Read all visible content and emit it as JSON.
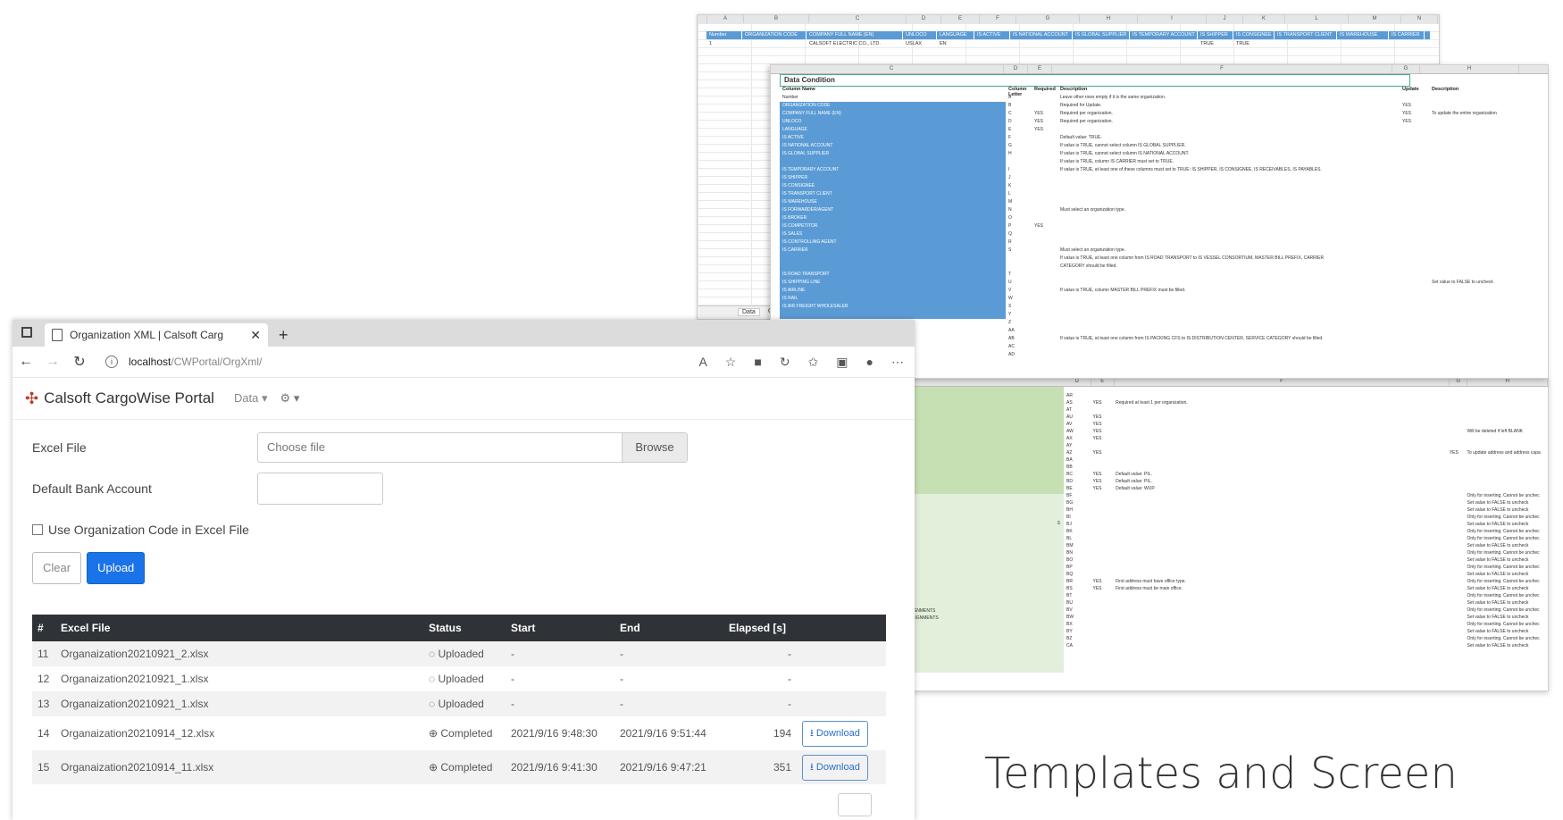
{
  "sheet1": {
    "col_letters": [
      "A",
      "B",
      "C",
      "D",
      "E",
      "F",
      "G",
      "H",
      "I",
      "J",
      "K",
      "L",
      "M",
      "N"
    ],
    "headers": [
      "Number",
      "ORGANIZATION CODE",
      "COMPANY FULL NAME (EN)",
      "UNLOCO",
      "LANGUAGE",
      "IS ACTIVE",
      "IS NATIONAL ACCOUNT",
      "IS GLOBAL SUPPLIER",
      "IS TEMPORARY ACCOUNT",
      "IS SHIPPER",
      "IS CONSIGNEE",
      "IS TRANSPORT CLIENT",
      "IS WAREHOUSE",
      "IS CARRIER"
    ],
    "row": [
      "1",
      "",
      "CALSOFT ELECTRIC CO., LTD.",
      "USLAX",
      "EN",
      "",
      "",
      "",
      "",
      "TRUE",
      "TRUE",
      "",
      "",
      ""
    ],
    "tabs": [
      "Data",
      "Cl"
    ]
  },
  "sheet2": {
    "title": "Data Condition",
    "head": {
      "name": "Column Name",
      "letter": "Column Letter",
      "req": "Required",
      "desc": "Description",
      "upd": "Update",
      "udesc": "Description"
    },
    "rows": [
      {
        "name": "Number",
        "letter": "A",
        "req": "",
        "desc": "Leave other rows empty if it is the same organization.",
        "upd": "",
        "udesc": ""
      },
      {
        "name": "ORGANIZATION CODE",
        "letter": "B",
        "req": "",
        "desc": "Required for Update.",
        "upd": "YES",
        "udesc": ""
      },
      {
        "name": "COMPANY FULL NAME (EN)",
        "letter": "C",
        "req": "YES",
        "desc": "Required per organization.",
        "upd": "YES",
        "udesc": "To update the entire organization"
      },
      {
        "name": "UNLOCO",
        "letter": "D",
        "req": "YES",
        "desc": "Required per organization.",
        "upd": "YES",
        "udesc": ""
      },
      {
        "name": "LANGUAGE",
        "letter": "E",
        "req": "YES",
        "desc": "",
        "upd": "",
        "udesc": ""
      },
      {
        "name": "IS ACTIVE",
        "letter": "F",
        "req": "",
        "desc": "Default value: TRUE.",
        "upd": "",
        "udesc": ""
      },
      {
        "name": "IS NATIONAL ACCOUNT",
        "letter": "G",
        "req": "",
        "desc": "If value is TRUE, cannot select column IS GLOBAL SUPPLIER.",
        "upd": "",
        "udesc": ""
      },
      {
        "name": "IS GLOBAL SUPPLIER",
        "letter": "H",
        "req": "",
        "desc": "If value is TRUE, cannot select column IS NATIONAL ACCOUNT.",
        "upd": "",
        "udesc": ""
      },
      {
        "name": "",
        "letter": "",
        "req": "",
        "desc": "If value is TRUE, column IS CARRIER must set to TRUE.",
        "upd": "",
        "udesc": ""
      },
      {
        "name": "IS TEMPORARY ACCOUNT",
        "letter": "I",
        "req": "",
        "desc": "If value is TRUE, at least one of these columns must set to TRUE: IS SHIPPER, IS CONSIGNEE, IS RECEIVABLES, IS PAYABLES.",
        "upd": "",
        "udesc": ""
      },
      {
        "name": "IS SHIPPER",
        "letter": "J",
        "req": "",
        "desc": "",
        "upd": "",
        "udesc": ""
      },
      {
        "name": "IS CONSIGNEE",
        "letter": "K",
        "req": "",
        "desc": "",
        "upd": "",
        "udesc": ""
      },
      {
        "name": "IS TRANSPORT CLIENT",
        "letter": "L",
        "req": "",
        "desc": "",
        "upd": "",
        "udesc": ""
      },
      {
        "name": "IS WAREHOUSE",
        "letter": "M",
        "req": "",
        "desc": "",
        "upd": "",
        "udesc": ""
      },
      {
        "name": "IS FORWARDER/AGENT",
        "letter": "N",
        "req": "",
        "desc": "Must select an organization type.",
        "upd": "",
        "udesc": ""
      },
      {
        "name": "IS BROKER",
        "letter": "O",
        "req": "",
        "desc": "",
        "upd": "",
        "udesc": ""
      },
      {
        "name": "IS COMPETITOR",
        "letter": "P",
        "req": "YES",
        "desc": "",
        "upd": "",
        "udesc": ""
      },
      {
        "name": "IS SALES",
        "letter": "Q",
        "req": "",
        "desc": "",
        "upd": "",
        "udesc": ""
      },
      {
        "name": "IS CONTROLLING AGENT",
        "letter": "R",
        "req": "",
        "desc": "",
        "upd": "",
        "udesc": ""
      },
      {
        "name": "IS CARRIER",
        "letter": "S",
        "req": "",
        "desc": "Must select an organization type.",
        "upd": "",
        "udesc": ""
      },
      {
        "name": "",
        "letter": "",
        "req": "",
        "desc": "If value is TRUE, at least one column from IS ROAD TRANSPORT to IS VESSEL CONSORTIUM, MASTER BILL PREFIX, CARRIER",
        "upd": "",
        "udesc": ""
      },
      {
        "name": "",
        "letter": "",
        "req": "",
        "desc": "CATEGORY should be filled.",
        "upd": "",
        "udesc": ""
      },
      {
        "name": "IS ROAD TRANSPORT",
        "letter": "T",
        "req": "",
        "desc": "",
        "upd": "",
        "udesc": ""
      },
      {
        "name": "IS SHIPPING LINE",
        "letter": "U",
        "req": "",
        "desc": "",
        "upd": "",
        "udesc": "Set value to FALSE to uncheck"
      },
      {
        "name": "IS AIRLINE",
        "letter": "V",
        "req": "",
        "desc": "If value is TRUE, column MASTER BILL PREFIX must be filled.",
        "upd": "",
        "udesc": ""
      },
      {
        "name": "IS RAIL",
        "letter": "W",
        "req": "",
        "desc": "",
        "upd": "",
        "udesc": ""
      },
      {
        "name": "IS AIR FREIGHT WHOLESALER",
        "letter": "X",
        "req": "",
        "desc": "",
        "upd": "",
        "udesc": ""
      },
      {
        "name": "",
        "letter": "Y",
        "req": "",
        "desc": "",
        "upd": "",
        "udesc": ""
      },
      {
        "name": "",
        "letter": "Z",
        "req": "",
        "desc": "",
        "upd": "",
        "udesc": ""
      },
      {
        "name": "",
        "letter": "AA",
        "req": "",
        "desc": "",
        "upd": "",
        "udesc": ""
      },
      {
        "name": "",
        "letter": "AB",
        "req": "",
        "desc": "If value is TRUE, at least one column from IS PACKING CFS to IS DISTRIBUTION CENTER, SERVICE CATEGORY should be filled.",
        "upd": "",
        "udesc": ""
      },
      {
        "name": "",
        "letter": "AC",
        "req": "",
        "desc": "",
        "upd": "",
        "udesc": ""
      },
      {
        "name": "",
        "letter": "AD",
        "req": "",
        "desc": "",
        "upd": "",
        "udesc": ""
      }
    ]
  },
  "sheet3": {
    "side_labels": [
      "S",
      "IGNMENTS",
      "SIGNMENTS"
    ],
    "rows": [
      {
        "letter": "AR",
        "req": "",
        "desc": "",
        "upd": "",
        "udesc": ""
      },
      {
        "letter": "AS",
        "req": "YES",
        "desc": "Required at least 1 per organization.",
        "upd": "",
        "udesc": ""
      },
      {
        "letter": "AT",
        "req": "",
        "desc": "",
        "upd": "",
        "udesc": ""
      },
      {
        "letter": "AU",
        "req": "YES",
        "desc": "",
        "upd": "",
        "udesc": ""
      },
      {
        "letter": "AV",
        "req": "YES",
        "desc": "",
        "upd": "",
        "udesc": ""
      },
      {
        "letter": "AW",
        "req": "YES",
        "desc": "",
        "upd": "",
        "udesc": "Will be deleted if left BLANK"
      },
      {
        "letter": "AX",
        "req": "YES",
        "desc": "",
        "upd": "",
        "udesc": ""
      },
      {
        "letter": "AY",
        "req": "",
        "desc": "",
        "upd": "",
        "udesc": ""
      },
      {
        "letter": "AZ",
        "req": "YES",
        "desc": "",
        "upd": "YES",
        "udesc": "To update address and address capa"
      },
      {
        "letter": "BA",
        "req": "",
        "desc": "",
        "upd": "",
        "udesc": ""
      },
      {
        "letter": "BB",
        "req": "",
        "desc": "",
        "upd": "",
        "udesc": ""
      },
      {
        "letter": "BC",
        "req": "YES",
        "desc": "Default value: PIL.",
        "upd": "",
        "udesc": ""
      },
      {
        "letter": "BD",
        "req": "YES",
        "desc": "Default value: PIL.",
        "upd": "",
        "udesc": ""
      },
      {
        "letter": "BE",
        "req": "YES",
        "desc": "Default value: WUP.",
        "upd": "",
        "udesc": ""
      },
      {
        "letter": "BF",
        "req": "",
        "desc": "",
        "upd": "",
        "udesc": "Only for inserting. Cannot be unchec"
      },
      {
        "letter": "BG",
        "req": "",
        "desc": "",
        "upd": "",
        "udesc": "Set value to FALSE to uncheck"
      },
      {
        "letter": "BH",
        "req": "",
        "desc": "",
        "upd": "",
        "udesc": "Set value to FALSE to uncheck"
      },
      {
        "letter": "BI",
        "req": "",
        "desc": "",
        "upd": "",
        "udesc": "Only for inserting. Cannot be unchec"
      },
      {
        "letter": "BJ",
        "req": "",
        "desc": "",
        "upd": "",
        "udesc": "Set value to FALSE to uncheck"
      },
      {
        "letter": "BK",
        "req": "",
        "desc": "",
        "upd": "",
        "udesc": "Only for inserting. Cannot be unchec"
      },
      {
        "letter": "BL",
        "req": "",
        "desc": "",
        "upd": "",
        "udesc": "Only for inserting. Cannot be unchec"
      },
      {
        "letter": "BM",
        "req": "",
        "desc": "",
        "upd": "",
        "udesc": "Set value to FALSE to uncheck"
      },
      {
        "letter": "BN",
        "req": "",
        "desc": "",
        "upd": "",
        "udesc": "Only for inserting. Cannot be unchec"
      },
      {
        "letter": "BO",
        "req": "",
        "desc": "",
        "upd": "",
        "udesc": "Set value to FALSE to uncheck"
      },
      {
        "letter": "BP",
        "req": "",
        "desc": "",
        "upd": "",
        "udesc": "Only for inserting. Cannot be unchec"
      },
      {
        "letter": "BQ",
        "req": "",
        "desc": "",
        "upd": "",
        "udesc": "Set value to FALSE to uncheck"
      },
      {
        "letter": "BR",
        "req": "YES",
        "desc": "First address must have office type.",
        "upd": "",
        "udesc": "Only for inserting. Cannot be unchec"
      },
      {
        "letter": "BS",
        "req": "YES",
        "desc": "First address must be main office.",
        "upd": "",
        "udesc": "Set value to FALSE to uncheck"
      },
      {
        "letter": "BT",
        "req": "",
        "desc": "",
        "upd": "",
        "udesc": "Only for inserting. Cannot be unchec"
      },
      {
        "letter": "BU",
        "req": "",
        "desc": "",
        "upd": "",
        "udesc": "Set value to FALSE to uncheck"
      },
      {
        "letter": "BV",
        "req": "",
        "desc": "",
        "upd": "",
        "udesc": "Only for inserting. Cannot be unchec"
      },
      {
        "letter": "BW",
        "req": "",
        "desc": "",
        "upd": "",
        "udesc": "Set value to FALSE to uncheck"
      },
      {
        "letter": "BX",
        "req": "",
        "desc": "",
        "upd": "",
        "udesc": "Only for inserting. Cannot be unchec"
      },
      {
        "letter": "BY",
        "req": "",
        "desc": "",
        "upd": "",
        "udesc": "Set value to FALSE to uncheck"
      },
      {
        "letter": "BZ",
        "req": "",
        "desc": "",
        "upd": "",
        "udesc": "Only for inserting. Cannot be unchec"
      },
      {
        "letter": "CA",
        "req": "",
        "desc": "",
        "upd": "",
        "udesc": "Set value to FALSE to uncheck"
      }
    ]
  },
  "browser": {
    "tab_title": "Organization XML | Calsoft Carg",
    "url_host": "localhost",
    "url_path": "/CWPortal/OrgXml/",
    "brand": "Calsoft CargoWise Portal",
    "nav_data": "Data ▾",
    "nav_settings": "⚙ ▾"
  },
  "form": {
    "excel_label": "Excel File",
    "file_placeholder": "Choose file",
    "browse_label": "Browse",
    "bank_label": "Default Bank Account",
    "checkbox_label": "Use Organization Code in Excel File",
    "clear_label": "Clear",
    "upload_label": "Upload"
  },
  "table": {
    "headers": [
      "#",
      "Excel File",
      "Status",
      "Start",
      "End",
      "Elapsed [s]"
    ],
    "rows": [
      {
        "num": "11",
        "file": "Organaization20210921_2.xlsx",
        "status": "Uploaded",
        "start": "-",
        "end": "-",
        "elapsed": "-",
        "download": ""
      },
      {
        "num": "12",
        "file": "Organaization20210921_1.xlsx",
        "status": "Uploaded",
        "start": "-",
        "end": "-",
        "elapsed": "-",
        "download": ""
      },
      {
        "num": "13",
        "file": "Organaization20210921_1.xlsx",
        "status": "Uploaded",
        "start": "-",
        "end": "-",
        "elapsed": "-",
        "download": ""
      },
      {
        "num": "14",
        "file": "Organaization20210914_12.xlsx",
        "status": "Completed",
        "start": "2021/9/16 9:48:30",
        "end": "2021/9/16 9:51:44",
        "elapsed": "194",
        "download": "Download"
      },
      {
        "num": "15",
        "file": "Organaization20210914_11.xlsx",
        "status": "Completed",
        "start": "2021/9/16 9:41:30",
        "end": "2021/9/16 9:47:21",
        "elapsed": "351",
        "download": "Download"
      }
    ]
  },
  "caption": "Templates and Screen",
  "colors": {
    "accent": "#1a73e8",
    "sheet_blue": "#5b9bd5",
    "sheet_green": "#c6e0b4",
    "table_header": "#2f3337"
  }
}
